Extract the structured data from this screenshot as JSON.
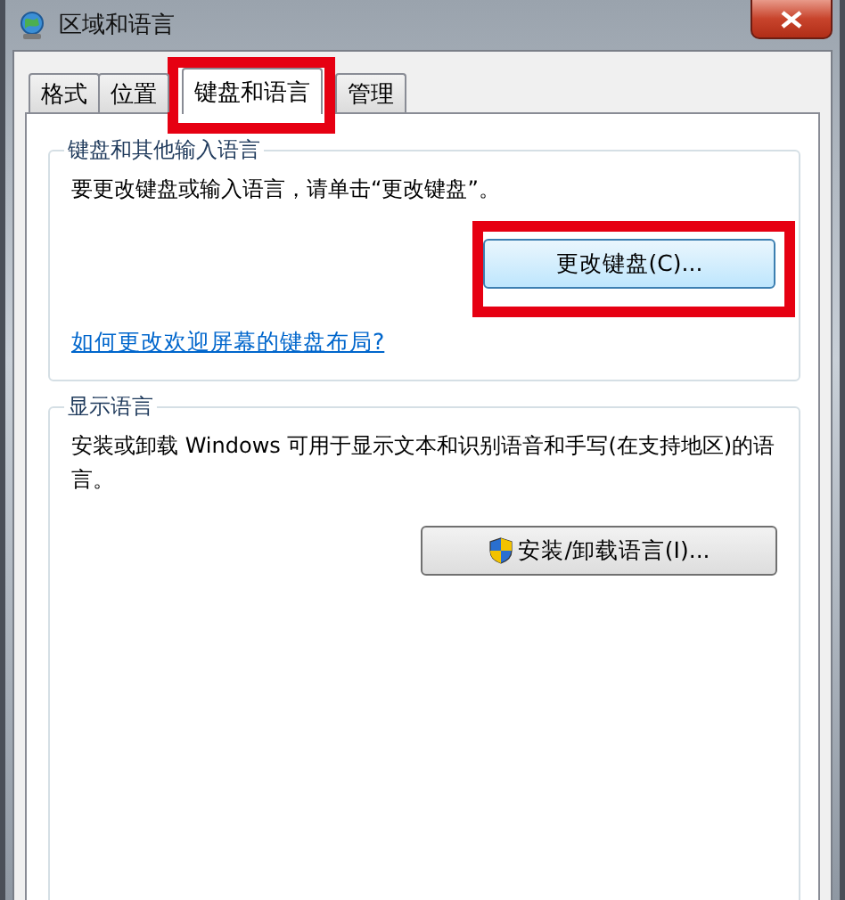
{
  "window": {
    "title": "区域和语言"
  },
  "tabs": [
    {
      "label": "格式",
      "selected": false,
      "highlighted": false
    },
    {
      "label": "位置",
      "selected": false,
      "highlighted": false
    },
    {
      "label": "键盘和语言",
      "selected": true,
      "highlighted": true
    },
    {
      "label": "管理",
      "selected": false,
      "highlighted": false
    }
  ],
  "groups": [
    {
      "title": "键盘和其他输入语言",
      "text": "要更改键盘或输入语言，请单击“更改键盘”。",
      "button": {
        "label": "更改键盘(C)...",
        "kind": "plain",
        "focused": true,
        "highlighted": true
      },
      "link": "如何更改欢迎屏幕的键盘布局?"
    },
    {
      "title": "显示语言",
      "text": "安装或卸载 Windows 可用于显示文本和识别语音和手写(在支持地区)的语言。",
      "button": {
        "label": "安装/卸载语言(I)...",
        "kind": "shield",
        "focused": false,
        "highlighted": false
      }
    }
  ]
}
